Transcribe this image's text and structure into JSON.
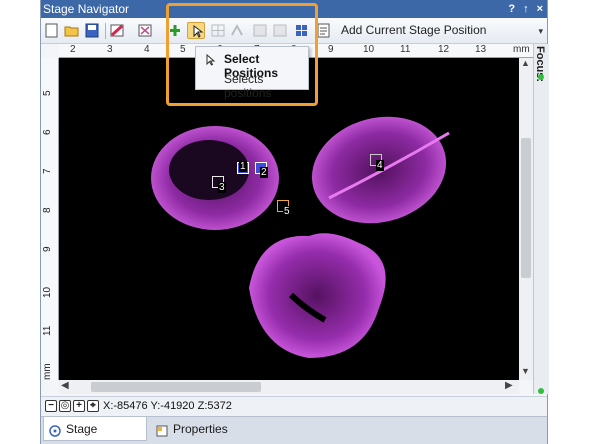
{
  "window": {
    "title": "Stage Navigator",
    "title_buttons": [
      "?",
      "↑",
      "×"
    ]
  },
  "toolbar": {
    "add_label": "Add Current Stage Position",
    "more": "▾",
    "icons": [
      "new-icon",
      "open-icon",
      "save-icon",
      "color-map-icon",
      "fit-icon",
      "add-position-icon",
      "select-positions-icon",
      "grid-icon",
      "pattern-icon",
      "move-back-icon",
      "move-forward-icon",
      "tiles-icon",
      "settings-icon"
    ]
  },
  "tooltip": {
    "title": "Select Positions",
    "description": "Selects positions"
  },
  "ruler": {
    "top_ticks": [
      "2",
      "3",
      "4",
      "5",
      "6",
      "7",
      "8",
      "9",
      "10",
      "11",
      "12",
      "13"
    ],
    "top_unit": "mm",
    "left_ticks": [
      "5",
      "6",
      "7",
      "8",
      "9",
      "10",
      "11",
      "12"
    ],
    "left_unit": "mm"
  },
  "canvas": {
    "markers": [
      "1",
      "2",
      "3",
      "4",
      "5"
    ],
    "marker_colors": [
      "#3b4fd8",
      "#3b4fd8",
      "#e8e8e8",
      "#c8c8c8",
      "#f2a640"
    ]
  },
  "focus": {
    "label": "Focus:"
  },
  "status": {
    "coordinates": "X:-85476 Y:-41920 Z:5372",
    "buttons": [
      "−",
      "◎",
      "+",
      "⌖"
    ]
  },
  "tabs": [
    {
      "label": "Stage Navigator",
      "active": true
    },
    {
      "label": "Properties",
      "active": false
    }
  ],
  "colors": {
    "titlebar": "#3d68a8",
    "highlight": "#f0a030",
    "sample": "#c34fd8"
  }
}
